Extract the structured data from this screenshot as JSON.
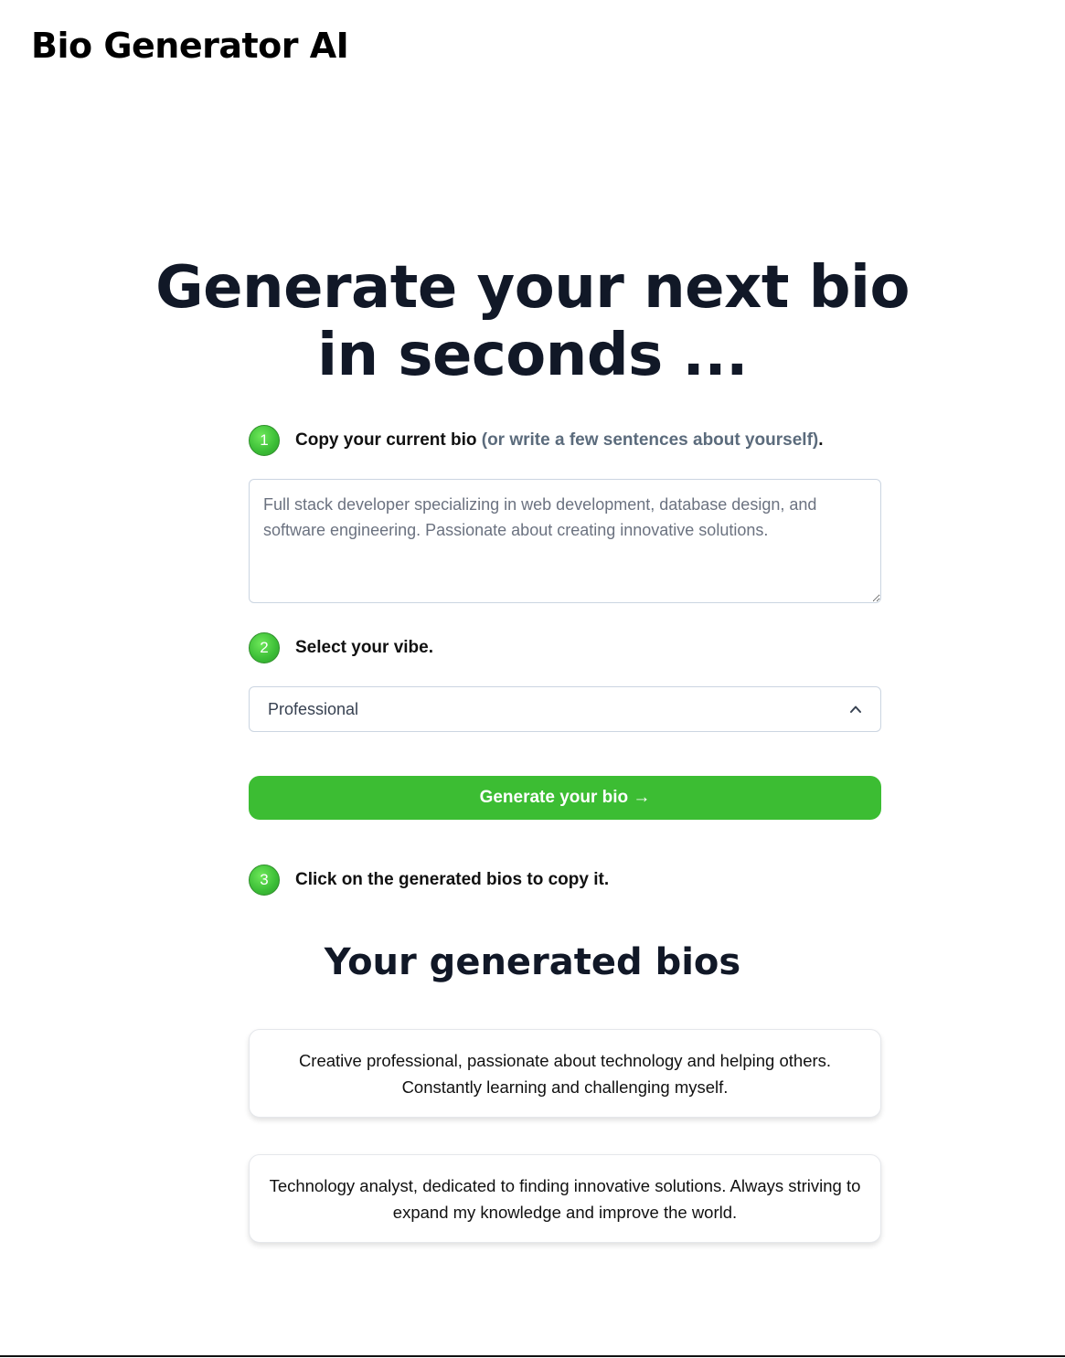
{
  "header": {
    "brand": "Bio Generator AI"
  },
  "hero": {
    "line1": "Generate your next bio",
    "line2": "in seconds ..."
  },
  "steps": [
    {
      "number": "1",
      "label": "Copy your current bio",
      "muted": "(or write a few sentences about yourself)",
      "suffix": "."
    },
    {
      "number": "2",
      "label": "Select your vibe."
    },
    {
      "number": "3",
      "label": "Click on the generated bios to copy it."
    }
  ],
  "bio_input": {
    "placeholder": "Full stack developer specializing in web development, database design, and software engineering. Passionate about creating innovative solutions.",
    "value": ""
  },
  "vibe_select": {
    "selected": "Professional",
    "icon": "chevron-up-icon"
  },
  "generate_button": {
    "label": "Generate your bio →"
  },
  "results": {
    "title": "Your generated bios",
    "bios": [
      "Creative professional, passionate about technology and helping others. Constantly learning and challenging myself.",
      "Technology analyst, dedicated to finding innovative solutions. Always striving to expand my knowledge and improve the world."
    ]
  },
  "colors": {
    "accent_green": "#3cbd33",
    "heading": "#111827",
    "muted_text": "#5b6b7c",
    "border": "#cbd5e1"
  }
}
